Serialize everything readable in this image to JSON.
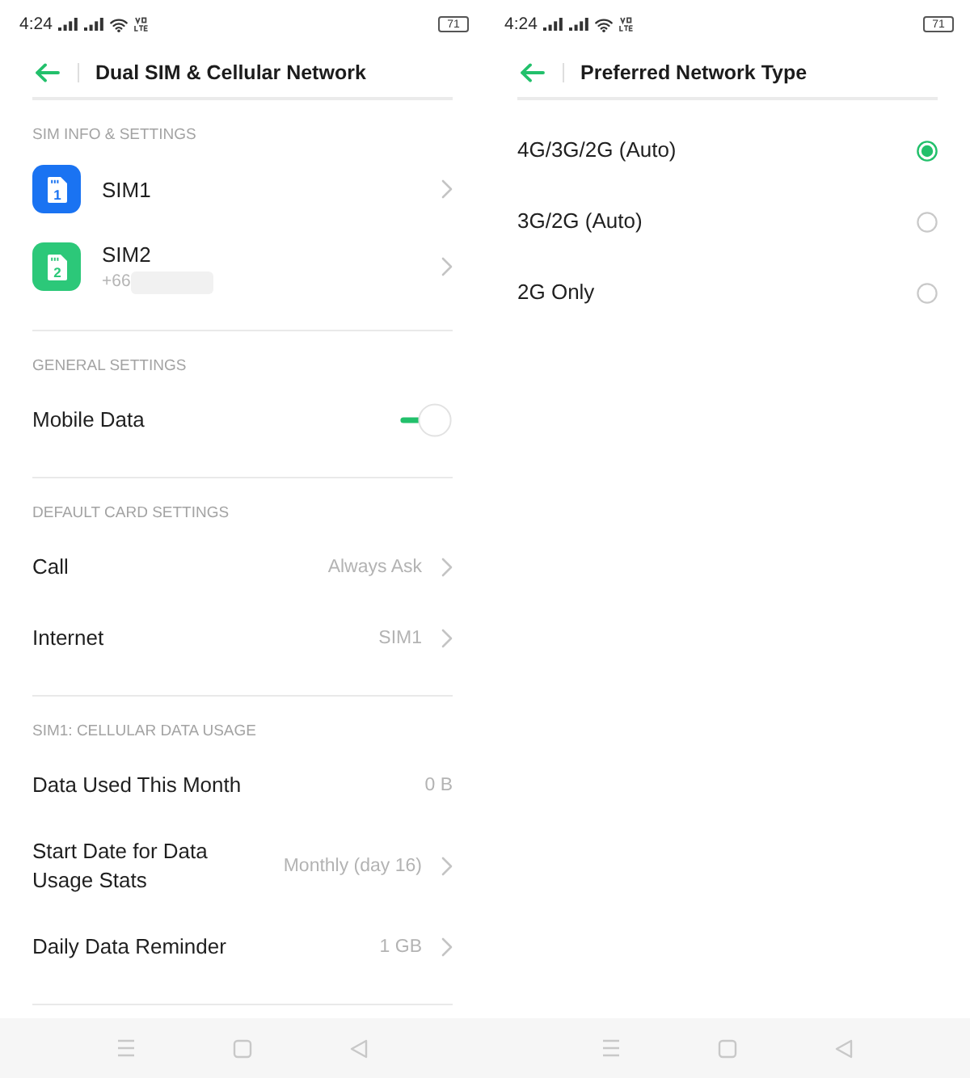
{
  "left_screen": {
    "status_bar": {
      "time": "4:24",
      "battery": "71"
    },
    "header": {
      "title": "Dual SIM & Cellular Network"
    },
    "sections": [
      {
        "heading": "SIM INFO & SETTINGS",
        "items": [
          {
            "kind": "sim",
            "label": "SIM1",
            "icon_digit": "1",
            "color": "#1a73f2"
          },
          {
            "kind": "sim",
            "label": "SIM2",
            "icon_digit": "2",
            "color": "#2cc879",
            "subtitle": "+66",
            "redacted": true
          }
        ]
      },
      {
        "heading": "GENERAL SETTINGS",
        "items": [
          {
            "kind": "toggle",
            "label": "Mobile Data",
            "on": true
          }
        ]
      },
      {
        "heading": "DEFAULT CARD SETTINGS",
        "items": [
          {
            "kind": "link",
            "label": "Call",
            "value": "Always Ask"
          },
          {
            "kind": "link",
            "label": "Internet",
            "value": "SIM1"
          }
        ]
      },
      {
        "heading": "SIM1: CELLULAR DATA USAGE",
        "items": [
          {
            "kind": "info",
            "label": "Data Used This Month",
            "value": "0 B"
          },
          {
            "kind": "link",
            "label": "Start Date for Data Usage Stats",
            "value": "Monthly (day 16)"
          },
          {
            "kind": "link",
            "label": "Daily Data Reminder",
            "value": "1 GB"
          }
        ]
      }
    ]
  },
  "right_screen": {
    "status_bar": {
      "time": "4:24",
      "battery": "71"
    },
    "header": {
      "title": "Preferred Network Type"
    },
    "options": [
      {
        "label": "4G/3G/2G (Auto)",
        "selected": true
      },
      {
        "label": "3G/2G (Auto)",
        "selected": false
      },
      {
        "label": "2G Only",
        "selected": false
      }
    ]
  }
}
